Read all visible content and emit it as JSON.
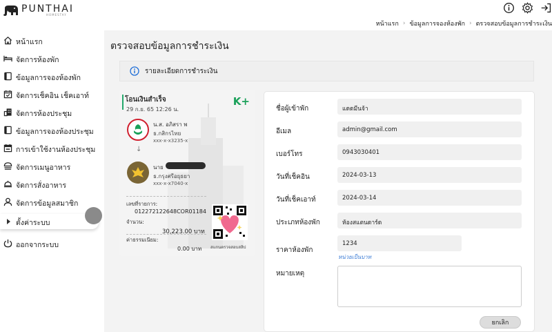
{
  "brand": {
    "name": "PUNTHAI",
    "sub": "HOMESTAY"
  },
  "topbar": {
    "icons": [
      "info-icon",
      "gear-icon",
      "logout-icon"
    ]
  },
  "breadcrumb": [
    "หน้าแรก",
    "ข้อมูลการจองห้องพัก",
    "ตรวจสอบข้อมูลการชำระเงิน"
  ],
  "sidebar": {
    "items": [
      {
        "label": "หน้าแรก",
        "icon": "home-icon"
      },
      {
        "label": "จัดการห้องพัก",
        "icon": "bed-icon"
      },
      {
        "label": "ข้อมูลการจองห้องพัก",
        "icon": "book-icon"
      },
      {
        "label": "จัดการเช็คอิน เช็คเอาท์",
        "icon": "calendar-check-icon"
      },
      {
        "label": "จัดการห้องประชุม",
        "icon": "building-icon"
      },
      {
        "label": "ข้อมูลการจองห้องประชุม",
        "icon": "book-icon"
      },
      {
        "label": "การเข้าใช้งานห้องประชุม",
        "icon": "calendar-icon"
      },
      {
        "label": "จัดการเมนูอาหาร",
        "icon": "food-icon"
      },
      {
        "label": "จัดการสั่งอาหาร",
        "icon": "serving-icon"
      },
      {
        "label": "จัดการข้อมูลสมาชิก",
        "icon": "user-icon"
      },
      {
        "label": "ตั้งค่าระบบ",
        "icon": "triangle-right-icon"
      },
      {
        "label": "ออกจากระบบ",
        "icon": "power-icon"
      }
    ]
  },
  "main": {
    "title": "ตรวจสอบข้อมูลการชำระเงิน",
    "info_text": "รายละเอียดการชำระเงิน"
  },
  "slip": {
    "title": "โอนเงินสำเร็จ",
    "date": "29 ก.ย. 65  12:26 น.",
    "brand": "K+",
    "sender": {
      "name": "น.ส. อภิสรา พ",
      "bank": "ธ.กสิกรไทย",
      "account": "xxx-x-x3235-x"
    },
    "arrow": "↓",
    "receiver": {
      "name": "นาย",
      "bank": "ธ.กรุงศรีอยุธยา",
      "account": "xxx-x-x7040-x"
    },
    "ref_label": "เลขที่รายการ:",
    "ref_value": "012272122648COR01184",
    "amount_label": "จำนวน:",
    "amount_value": "30,223.00 บาท",
    "fee_label": "ค่าธรรมเนียม:",
    "fee_value": "0.00 บาท",
    "qr_caption": "สแกนตรวจสอบสลิป",
    "colors": {
      "kplus": "#1ba15a",
      "kbank": "#d01f2e",
      "krungsri": "#7a6535"
    }
  },
  "form": {
    "fields": [
      {
        "label": "ชื่อผู้เข้าพัก",
        "value": "แดดมีนจ้า"
      },
      {
        "label": "อีเมล",
        "value": "admin@gmail.com"
      },
      {
        "label": "เบอร์โทร",
        "value": "0943030401"
      },
      {
        "label": "วันที่เช็คอิน",
        "value": "2024-03-13"
      },
      {
        "label": "วันที่เช็คเอาท์",
        "value": "2024-03-14"
      },
      {
        "label": "ประเภทห้องพัก",
        "value": "ห้องสแตนดาร์ด"
      },
      {
        "label": "ราคาห้องพัก",
        "value": "1234"
      },
      {
        "label": "หมายเหตุ",
        "value": ""
      }
    ],
    "price_hint": "หน่วยเป็นบาท",
    "cancel_label": "ยกเลิก"
  }
}
